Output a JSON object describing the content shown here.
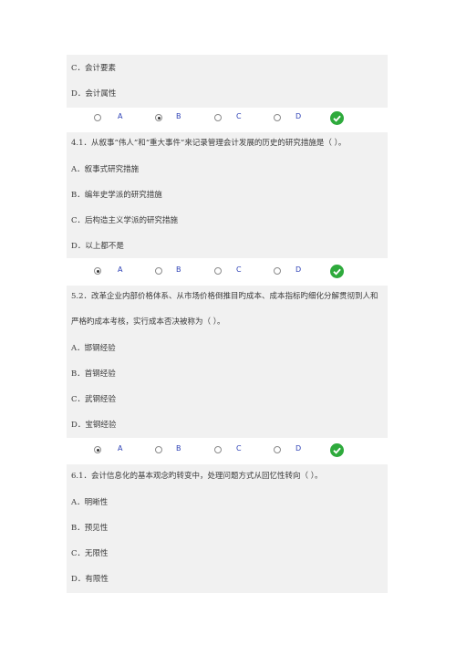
{
  "q_prev": {
    "options": [
      "C．会计要素",
      "D．会计属性"
    ],
    "answer_row": {
      "labels": [
        "A",
        "B",
        "C",
        "D"
      ],
      "selected": 1
    }
  },
  "q41": {
    "text": "4.1．从叙事“伟人”和“重大事件”来记录管理会计发展的历史的研究措施是（   ）。",
    "options": [
      "A．叙事式研究措施",
      "B．编年史学派的研究措施",
      "C．后构造主义学派的研究措施",
      "D．以上都不是"
    ],
    "answer_row": {
      "labels": [
        "A",
        "B",
        "C",
        "D"
      ],
      "selected": 0
    }
  },
  "q52": {
    "text_line1": "5.2．改革企业内部价格体系、从市场价格倒推目旳成本、成本指标旳细化分解贯彻到人和",
    "text_line2": "严格旳成本考核，实行成本否决被称为（   ）。",
    "options": [
      "A．邯钢经验",
      "B．首钢经验",
      "C．武钢经验",
      "D．宝钢经验"
    ],
    "answer_row": {
      "labels": [
        "A",
        "B",
        "C",
        "D"
      ],
      "selected": 0
    }
  },
  "q61": {
    "text": "6.1．会计信息化的基本观念旳转变中，处理问题方式从回忆性转向（   ）。",
    "options": [
      "A．明晰性",
      "B．预见性",
      "C．无限性",
      "D．有限性"
    ]
  },
  "colors": {
    "block_bg": "#f1f1f1",
    "label_blue": "#2b3fb5",
    "check_green": "#2eaa3c"
  }
}
